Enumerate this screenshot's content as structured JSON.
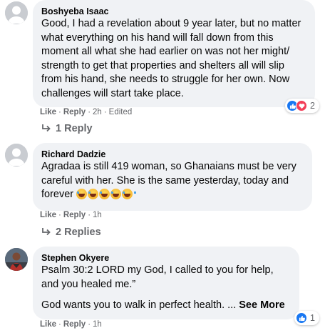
{
  "comments": [
    {
      "author": "Boshyeba Isaac",
      "text": "Good, I had a revelation about 9 year later, but no matter what everything on his hand will fall down from this moment all what she had earlier on was not her might/ strength to get that properties and shelters all will slip from his hand, she needs to struggle for her own. Now challenges will start take place.",
      "like_label": "Like",
      "reply_label": "Reply",
      "time": "2h",
      "edited": "Edited",
      "reaction_count": "2",
      "reactions": [
        "like-icon",
        "love-icon"
      ],
      "replies_label": "1 Reply"
    },
    {
      "author": "Richard Dadzie",
      "text": "Agradaa is still 419 woman, so Ghanaians must be very careful with her. She is the same yesterday, today and forever",
      "emoji_count": 5,
      "emoji_icon": "laughing-crying-emoji-icon",
      "like_label": "Like",
      "reply_label": "Reply",
      "time": "1h",
      "replies_label": "2 Replies"
    },
    {
      "author": "Stephen Okyere",
      "text": "Psalm 30:2 LORD my God, I called to you for help, and you healed me.”",
      "text2": "God wants you to walk in perfect health. ...",
      "see_more": "See More",
      "like_label": "Like",
      "reply_label": "Reply",
      "time": "1h",
      "reaction_count": "1",
      "reactions": [
        "like-icon"
      ]
    }
  ],
  "colors": {
    "bubble": "#f0f2f5",
    "meta": "#65676b",
    "like_blue": "#1877f2",
    "love_red": "#f33e58"
  }
}
